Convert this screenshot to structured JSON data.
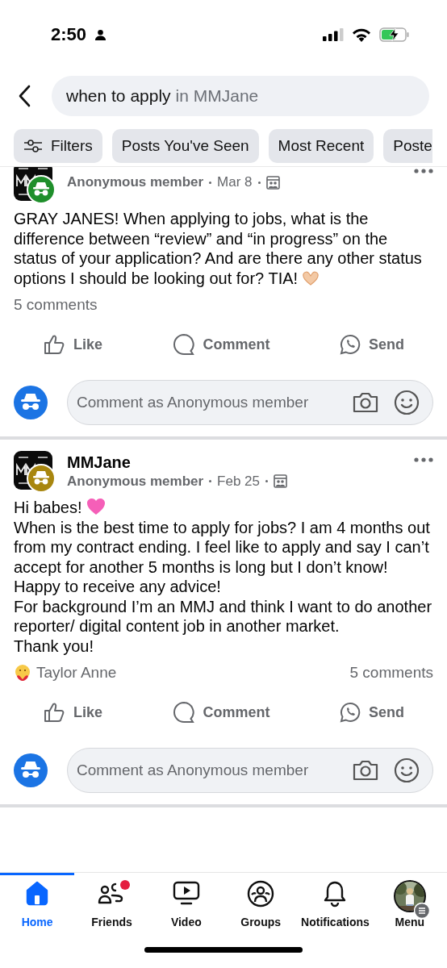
{
  "status_bar": {
    "time": "2:50"
  },
  "search": {
    "query": "when to apply",
    "scope": "in MMJane"
  },
  "chips": [
    {
      "label": "Filters",
      "kind": "filter"
    },
    {
      "label": "Posts You've Seen",
      "kind": "plain"
    },
    {
      "label": "Most Recent",
      "kind": "plain"
    },
    {
      "label": "Poste",
      "kind": "plain"
    }
  ],
  "posts": [
    {
      "author": "Anonymous member",
      "date": "Mar 8",
      "color": "#1f8f2b",
      "paragraphs": [
        {
          "text": "GRAY JANES! When applying to jobs, what is the difference between “review” and “in progress” on the status of your application? And are there any other status options I should be looking out for? TIA!",
          "kind": "hands"
        }
      ],
      "comments": "5 comments",
      "actions": [
        "Like",
        "Comment",
        "Send"
      ],
      "comment_placeholder": "Comment as Anonymous member"
    },
    {
      "group": "MMJane",
      "author": "Anonymous member",
      "date": "Feb 25",
      "color": "#a8860f",
      "paragraphs": [
        {
          "text": "Hi babes!",
          "kind": "heart"
        },
        {
          "text": "When is the best time to apply for jobs? I am 4 months out from my contract ending. I feel like to apply and say I can’t accept for another 5 months is long but I don’t know!",
          "kind": "plain"
        },
        {
          "text": "Happy to receive any advice!",
          "kind": "plain"
        },
        {
          "text": "For background I’m an MMJ and think I want to do another reporter/ digital content job in another market.",
          "kind": "plain"
        },
        {
          "text": "Thank you!",
          "kind": "plain"
        }
      ],
      "reactor": "Taylor Anne",
      "comments": "5 comments",
      "actions": [
        "Like",
        "Comment",
        "Send"
      ],
      "comment_placeholder": "Comment as Anonymous member"
    }
  ],
  "nav": [
    {
      "label": "Home",
      "kind": "home",
      "selected": true,
      "badge": false
    },
    {
      "label": "Friends",
      "kind": "friends",
      "selected": false,
      "badge": true
    },
    {
      "label": "Video",
      "kind": "video",
      "selected": false,
      "badge": false
    },
    {
      "label": "Groups",
      "kind": "groups",
      "selected": false,
      "badge": false
    },
    {
      "label": "Notifications",
      "kind": "bell",
      "selected": false,
      "badge": false
    },
    {
      "label": "Menu",
      "kind": "menu",
      "selected": false,
      "badge": false
    }
  ]
}
